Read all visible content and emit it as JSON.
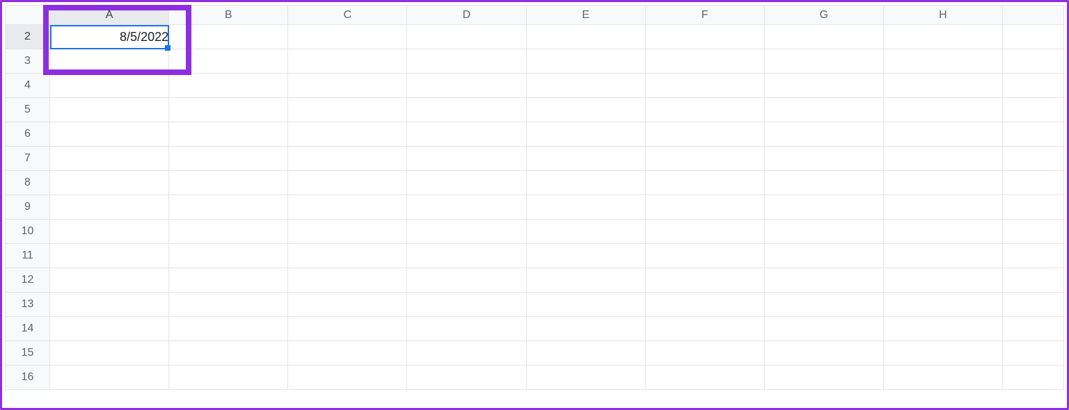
{
  "columns": [
    "A",
    "B",
    "C",
    "D",
    "E",
    "F",
    "G",
    "H",
    ""
  ],
  "rows": [
    "2",
    "3",
    "4",
    "5",
    "6",
    "7",
    "8",
    "9",
    "10",
    "11",
    "12",
    "13",
    "14",
    "15",
    "16"
  ],
  "active_cell": {
    "row": "2",
    "col": "A",
    "value": "8/5/2022"
  },
  "annotation_color": "#8d2fe0",
  "selection_color": "#1a73e8"
}
